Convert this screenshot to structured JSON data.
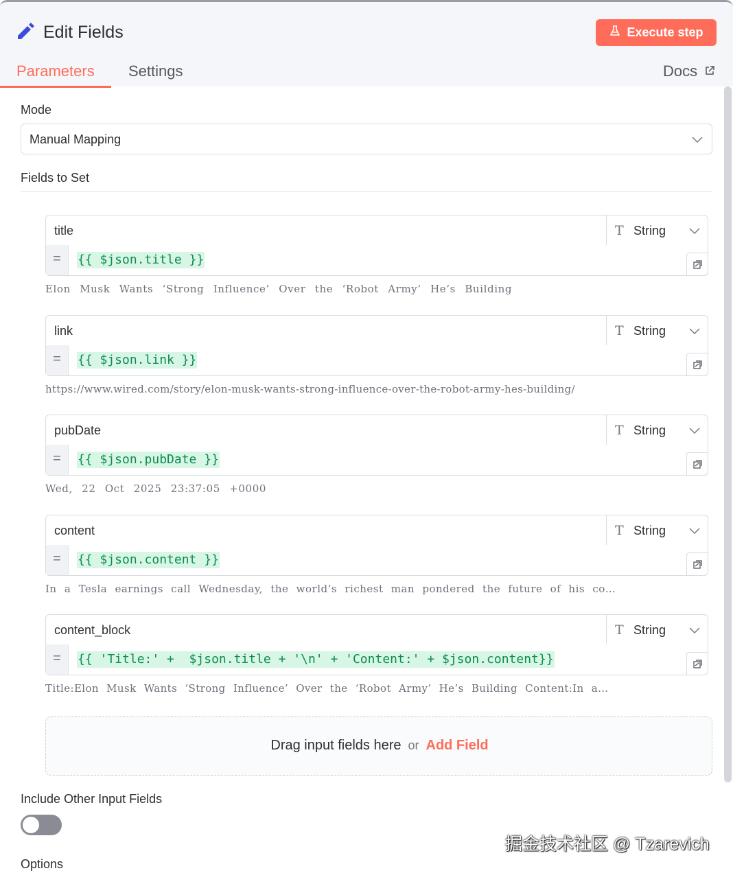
{
  "header": {
    "title": "Edit Fields",
    "execute_label": "Execute step",
    "tabs": [
      "Parameters",
      "Settings"
    ],
    "docs_label": "Docs"
  },
  "mode": {
    "label": "Mode",
    "value": "Manual Mapping"
  },
  "fields_section": {
    "label": "Fields to Set",
    "fields": [
      {
        "name": "title",
        "type": "String",
        "eq": "=",
        "expression": "{{ $json.title }}",
        "preview": "Elon Musk Wants ‘Strong Influence’ Over the ‘Robot Army’ He’s Building"
      },
      {
        "name": "link",
        "type": "String",
        "eq": "=",
        "expression": "{{ $json.link }}",
        "preview": "https://www.wired.com/story/elon-musk-wants-strong-influence-over-the-robot-army-hes-building/"
      },
      {
        "name": "pubDate",
        "type": "String",
        "eq": "=",
        "expression": "{{ $json.pubDate }}",
        "preview": "Wed, 22 Oct 2025 23:37:05 +0000"
      },
      {
        "name": "content",
        "type": "String",
        "eq": "=",
        "expression": "{{ $json.content }}",
        "preview": "In a Tesla earnings call Wednesday, the world’s richest man pondered the future of his co…"
      },
      {
        "name": "content_block",
        "type": "String",
        "eq": "=",
        "expression": "{{ 'Title:' +  $json.title + '\\n' + 'Content:' + $json.content}}",
        "preview": "Title:Elon Musk Wants ‘Strong Influence’ Over the ‘Robot Army’ He’s Building Content:In a…"
      }
    ],
    "drop_text": "Drag input fields here",
    "drop_or": "or",
    "add_field_label": "Add Field"
  },
  "include_other": {
    "label": "Include Other Input Fields",
    "enabled": false
  },
  "options_label": "Options",
  "watermark": "掘金技术社区 @ Tzarevich",
  "colors": {
    "accent": "#ff6d5a",
    "expression_text": "#0e8a4e",
    "expression_bg": "#d7f6e6"
  },
  "icons": {
    "title": "pencil-icon",
    "execute": "flask-icon",
    "docs": "external-link-icon",
    "type": "text-type-icon",
    "dropdown": "chevron-down-icon",
    "mapping": "mapping-toggle-icon"
  }
}
